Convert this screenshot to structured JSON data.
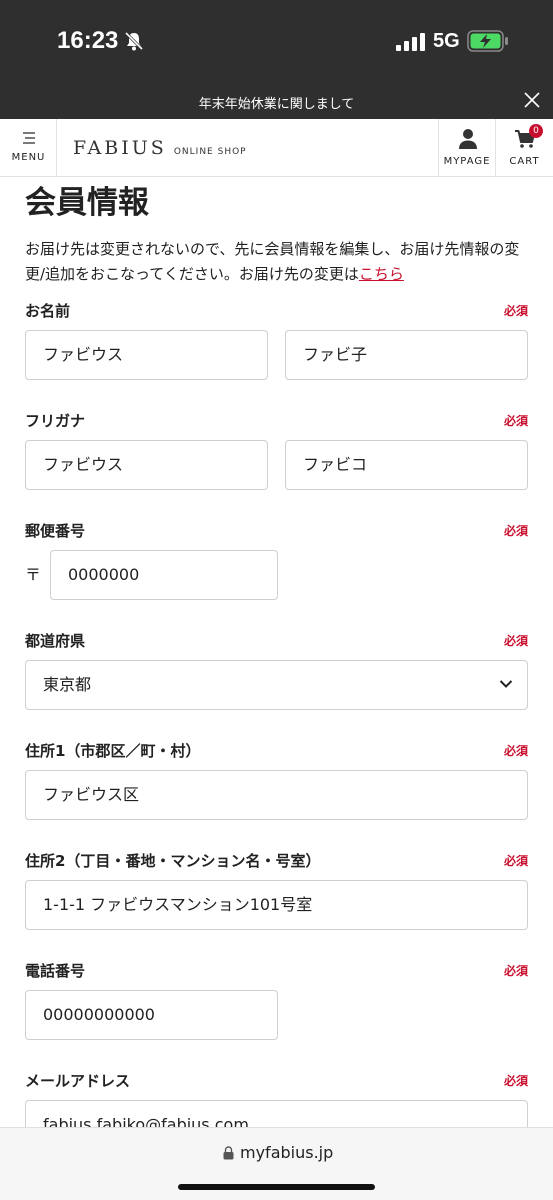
{
  "status_bar": {
    "time": "16:23",
    "network": "5G"
  },
  "notice": {
    "text": "年末年始休業に関しまして"
  },
  "header": {
    "menu_label": "MENU",
    "logo_main": "FABIUS",
    "logo_sub": "ONLINE SHOP",
    "mypage_label": "MYPAGE",
    "cart_label": "CART",
    "cart_count": "0"
  },
  "page": {
    "title": "会員情報",
    "intro_text": "お届け先は変更されないので、先に会員情報を編集し、お届け先情報の変更/追加をおこなってください。お届け先の変更は",
    "intro_link": "こちら",
    "required_label": "必須"
  },
  "form": {
    "name": {
      "label": "お名前",
      "last": "ファビウス",
      "first": "ファビ子"
    },
    "kana": {
      "label": "フリガナ",
      "last": "ファビウス",
      "first": "ファビコ"
    },
    "postal": {
      "label": "郵便番号",
      "mark": "〒",
      "value": "0000000"
    },
    "prefecture": {
      "label": "都道府県",
      "value": "東京都"
    },
    "address1": {
      "label": "住所1（市郡区／町・村）",
      "value": "ファビウス区"
    },
    "address2": {
      "label": "住所2（丁目・番地・マンション名・号室）",
      "value": "1-1-1 ファビウスマンション101号室"
    },
    "phone": {
      "label": "電話番号",
      "value": "00000000000"
    },
    "email": {
      "label": "メールアドレス",
      "value": "fabius.fabiko@fabius.com"
    }
  },
  "browser": {
    "url": "myfabius.jp"
  },
  "colors": {
    "accent": "#c8102e",
    "dark_bar": "#2f2f2f",
    "battery": "#4cd964"
  }
}
